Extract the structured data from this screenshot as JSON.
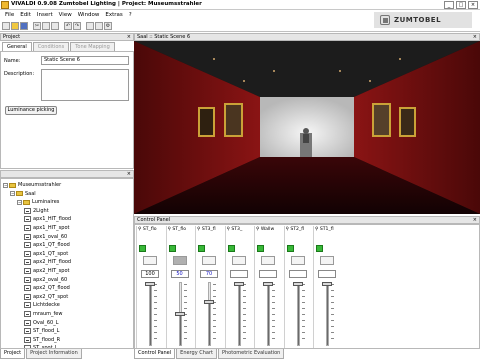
{
  "window": {
    "title": "VIVALDI 0.9.08 Zumtobel Lighting | Project: Museumsstrahler",
    "brand": "ZUMTOBEL"
  },
  "menu": [
    "File",
    "Edit",
    "Insert",
    "View",
    "Window",
    "Extras",
    "?"
  ],
  "toolbar_icons": [
    "new-icon",
    "open-icon",
    "save-icon",
    "cut-icon",
    "copy-icon",
    "paste-icon",
    "undo-icon",
    "redo-icon",
    "print-icon",
    "zoom-icon",
    "settings-icon"
  ],
  "project_panel": {
    "header": "Project",
    "tabs": [
      {
        "label": "General",
        "active": true
      },
      {
        "label": "Conditions",
        "active": false
      },
      {
        "label": "Tone Mapping",
        "active": false
      }
    ],
    "name_label": "Name:",
    "name_value": "Static Scene 6",
    "description_label": "Description:",
    "button": "Luminance picking"
  },
  "tree": {
    "items": [
      {
        "label": "Museumsstrahler",
        "level": 0,
        "kind": "folder",
        "expanded": true
      },
      {
        "label": "Saal",
        "level": 1,
        "kind": "folder",
        "expanded": true
      },
      {
        "label": "Luminaires",
        "level": 2,
        "kind": "folder",
        "expanded": true
      },
      {
        "label": "2Light",
        "level": 3,
        "kind": "luminaire"
      },
      {
        "label": "apx1_HIT_flood",
        "level": 3,
        "kind": "luminaire"
      },
      {
        "label": "apx1_HIT_spot",
        "level": 3,
        "kind": "luminaire"
      },
      {
        "label": "apx1_oval_60",
        "level": 3,
        "kind": "luminaire"
      },
      {
        "label": "apx1_QT_flood",
        "level": 3,
        "kind": "luminaire"
      },
      {
        "label": "apx1_QT_spot",
        "level": 3,
        "kind": "luminaire"
      },
      {
        "label": "apx2_HIT_flood",
        "level": 3,
        "kind": "luminaire"
      },
      {
        "label": "apx2_HIT_spot",
        "level": 3,
        "kind": "luminaire"
      },
      {
        "label": "apx2_oval_60",
        "level": 3,
        "kind": "luminaire"
      },
      {
        "label": "apx2_QT_flood",
        "level": 3,
        "kind": "luminaire"
      },
      {
        "label": "apx2_QT_spot",
        "level": 3,
        "kind": "luminaire"
      },
      {
        "label": "Lichtdecke",
        "level": 3,
        "kind": "luminaire"
      },
      {
        "label": "mraum_few",
        "level": 3,
        "kind": "luminaire"
      },
      {
        "label": "Oval_60_L",
        "level": 3,
        "kind": "luminaire"
      },
      {
        "label": "ST_flood_L",
        "level": 3,
        "kind": "luminaire"
      },
      {
        "label": "ST_flood_R",
        "level": 3,
        "kind": "luminaire"
      },
      {
        "label": "ST_spot_L",
        "level": 3,
        "kind": "luminaire"
      }
    ]
  },
  "bottom_tabs": [
    {
      "label": "Project",
      "active": true
    },
    {
      "label": "Project Information",
      "active": false
    }
  ],
  "viewport": {
    "header": "Saal :: Static Scene 6"
  },
  "control_panel": {
    "header": "Control Panel",
    "channels": [
      {
        "label": "ST_flo",
        "value": "100",
        "level": 1.0,
        "swatch": "light",
        "blue": false
      },
      {
        "label": "ST_flo",
        "value": "50",
        "level": 0.5,
        "swatch": "dark",
        "blue": true
      },
      {
        "label": "ST3_fl",
        "value": "70",
        "level": 0.7,
        "swatch": "light",
        "blue": true
      },
      {
        "label": "ST3_",
        "value": "",
        "level": 1.0,
        "swatch": "light",
        "blue": false
      },
      {
        "label": "Wallw",
        "value": "",
        "level": 1.0,
        "swatch": "light",
        "blue": false
      },
      {
        "label": "ST2_fl",
        "value": "",
        "level": 1.0,
        "swatch": "light",
        "blue": false
      },
      {
        "label": "ST1_fl",
        "value": "",
        "level": 1.0,
        "swatch": "light",
        "blue": false
      }
    ],
    "tabs": [
      {
        "label": "Control Panel",
        "active": true
      },
      {
        "label": "Energy Chart",
        "active": false
      },
      {
        "label": "Photometric Evaluation",
        "active": false
      }
    ]
  }
}
